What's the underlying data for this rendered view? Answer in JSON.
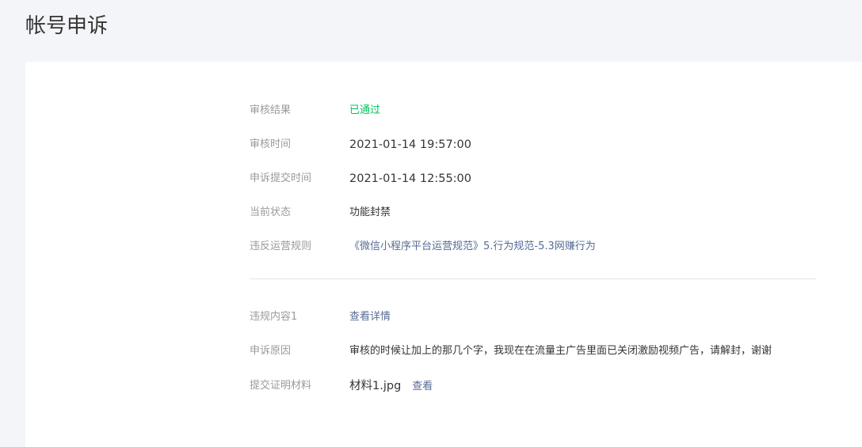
{
  "page": {
    "title": "帐号申诉"
  },
  "review": {
    "result_label": "审核结果",
    "result_value": "已通过",
    "review_time_label": "审核时间",
    "review_time_value": "2021-01-14 19:57:00",
    "submit_time_label": "申诉提交时间",
    "submit_time_value": "2021-01-14 12:55:00",
    "status_label": "当前状态",
    "status_value": "功能封禁",
    "rule_label": "违反运营规则",
    "rule_value": "《微信小程序平台运营规范》5.行为规范-5.3网赚行为"
  },
  "appeal": {
    "violation_label": "违规内容1",
    "violation_link": "查看详情",
    "reason_label": "申诉原因",
    "reason_value": "审核的时候让加上的那几个字，我现在在流量主广告里面已关闭激励视频广告，请解封，谢谢",
    "materials_label": "提交证明材料",
    "material_file": "材料1.jpg",
    "material_view": "查看"
  },
  "colors": {
    "success": "#07c160",
    "link": "#576b95",
    "label": "#9a9a9a",
    "background": "#f4f5f9"
  }
}
